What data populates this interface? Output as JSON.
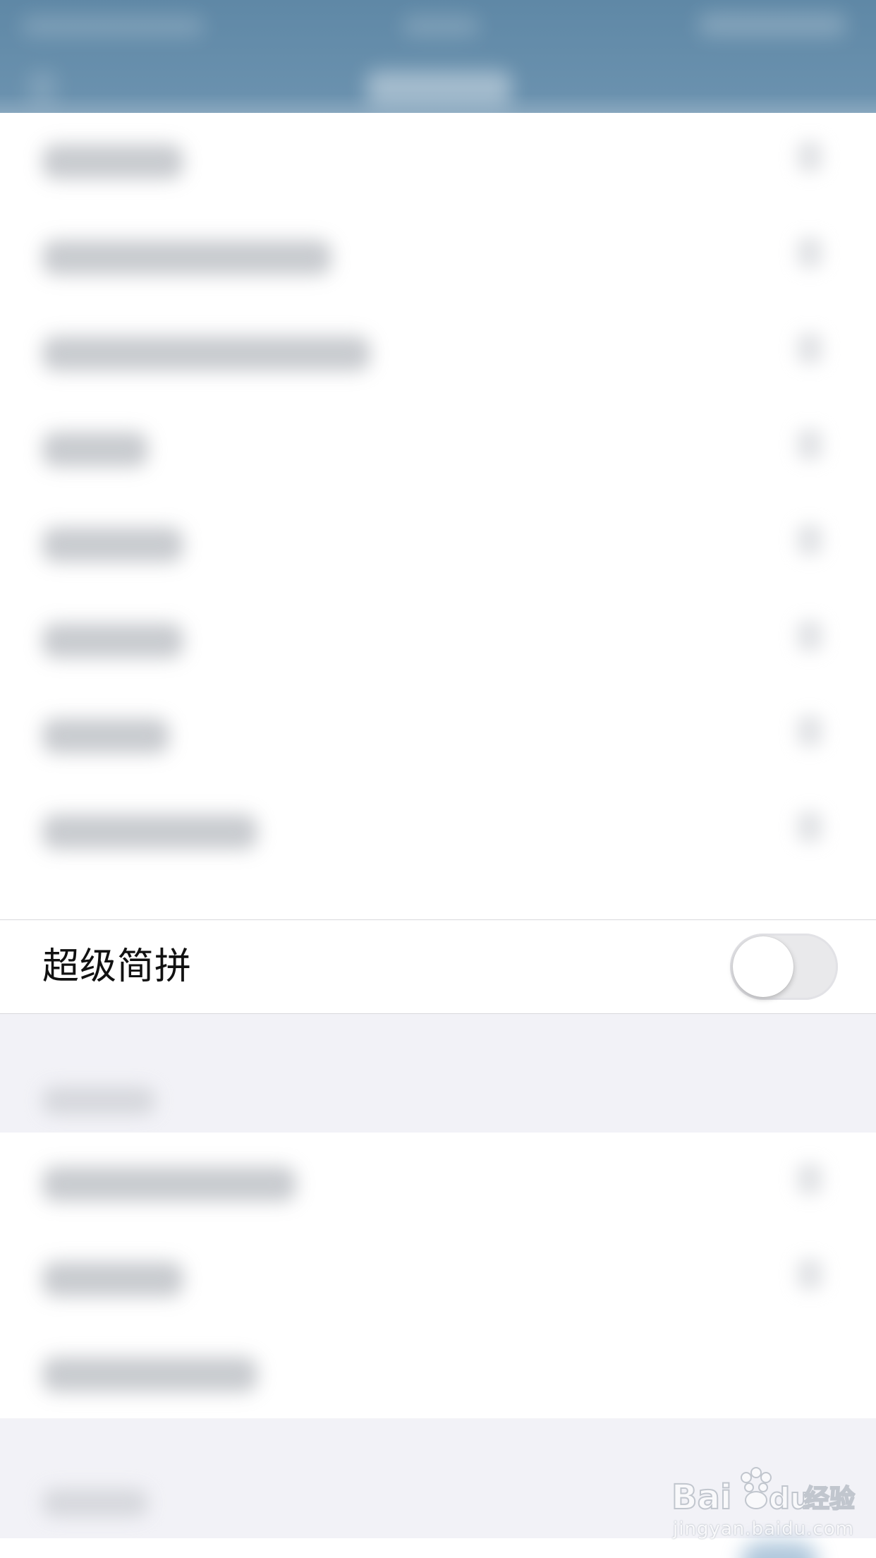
{
  "settings": {
    "super_jianpin": {
      "label": "超级简拼",
      "enabled": false
    }
  },
  "watermark": {
    "brand": "Baidu经验",
    "url": "jingyan.baidu.com"
  },
  "colors": {
    "header_bg": "#5f88a6",
    "switch_off_track": "#e9e9eb",
    "switch_knob": "#ffffff",
    "page_bg": "#f2f2f7",
    "row_bg": "#ffffff"
  }
}
